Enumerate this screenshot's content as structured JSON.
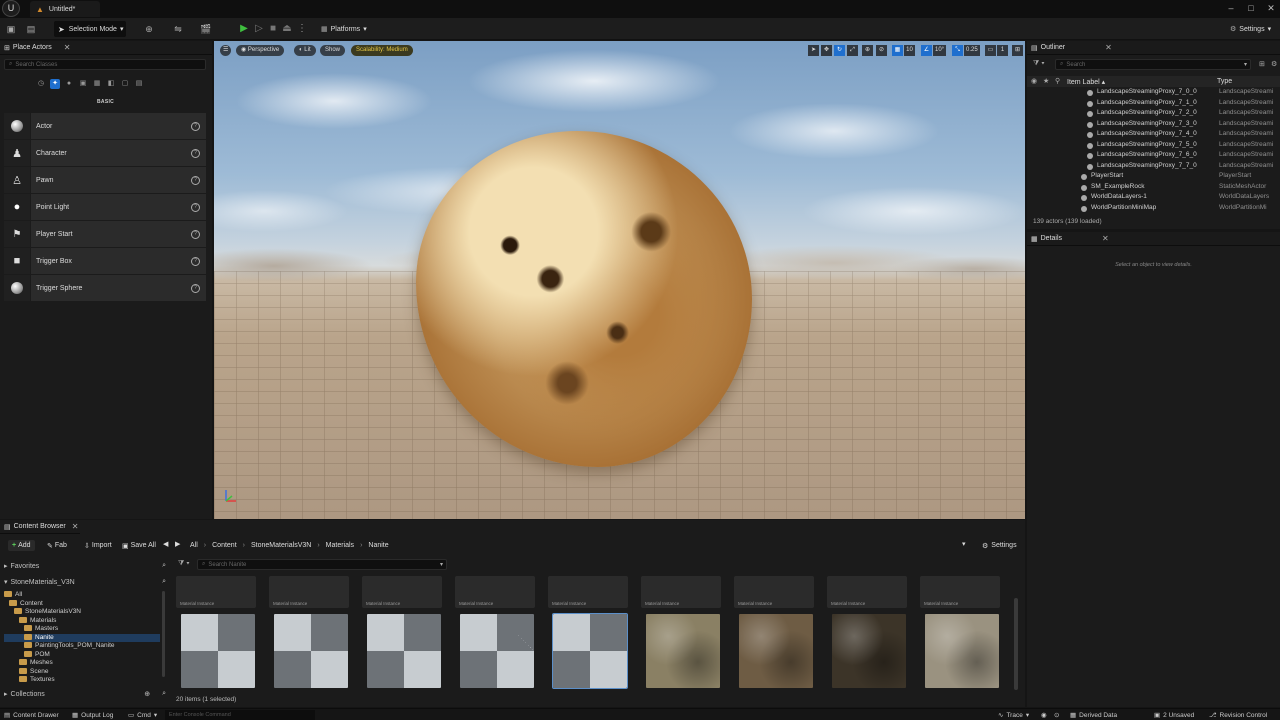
{
  "window": {
    "doc_tab": "Untitled*",
    "controls": [
      "–",
      "□",
      "✕"
    ]
  },
  "toolbar": {
    "selection_mode": "Selection Mode",
    "platforms": "Platforms",
    "settings": "Settings"
  },
  "place_actors": {
    "title": "Place Actors",
    "search_placeholder": "Search Classes",
    "category": "BASIC",
    "items": [
      {
        "label": "Actor"
      },
      {
        "label": "Character"
      },
      {
        "label": "Pawn"
      },
      {
        "label": "Point Light"
      },
      {
        "label": "Player Start"
      },
      {
        "label": "Trigger Box"
      },
      {
        "label": "Trigger Sphere"
      }
    ]
  },
  "viewport": {
    "perspective": "Perspective",
    "lit": "Lit",
    "show": "Show",
    "scalability": "Scalability: Medium",
    "grid_value": "10",
    "angle_value": "10°",
    "scale_value": "0.25",
    "camera_value": "1"
  },
  "outliner": {
    "title": "Outliner",
    "search_placeholder": "Search",
    "col_label": "Item Label ▴",
    "col_type": "Type",
    "rows": [
      {
        "label": "LandscapeStreamingProxy_7_0_0",
        "type": "LandscapeStreami"
      },
      {
        "label": "LandscapeStreamingProxy_7_1_0",
        "type": "LandscapeStreami"
      },
      {
        "label": "LandscapeStreamingProxy_7_2_0",
        "type": "LandscapeStreami"
      },
      {
        "label": "LandscapeStreamingProxy_7_3_0",
        "type": "LandscapeStreami"
      },
      {
        "label": "LandscapeStreamingProxy_7_4_0",
        "type": "LandscapeStreami"
      },
      {
        "label": "LandscapeStreamingProxy_7_5_0",
        "type": "LandscapeStreami"
      },
      {
        "label": "LandscapeStreamingProxy_7_6_0",
        "type": "LandscapeStreami"
      },
      {
        "label": "LandscapeStreamingProxy_7_7_0",
        "type": "LandscapeStreami"
      },
      {
        "label": "PlayerStart",
        "type": "PlayerStart"
      },
      {
        "label": "SM_ExampleRock",
        "type": "StaticMeshActor"
      },
      {
        "label": "WorldDataLayers-1",
        "type": "WorldDataLayers"
      },
      {
        "label": "WorldPartitionMiniMap",
        "type": "WorldPartitionMi"
      }
    ],
    "count": "139 actors (139 loaded)"
  },
  "details": {
    "title": "Details",
    "empty": "Select an object to view details."
  },
  "content_browser": {
    "title": "Content Browser",
    "add": "Add",
    "fab": "Fab",
    "import": "Import",
    "save_all": "Save All",
    "breadcrumb": [
      "All",
      "Content",
      "StoneMaterialsV3N",
      "Materials",
      "Nanite"
    ],
    "settings": "Settings",
    "favorites": "Favorites",
    "project": "StoneMaterials_V3N",
    "search_placeholder": "Search Nanite",
    "tree": [
      {
        "label": "All",
        "indent": 0
      },
      {
        "label": "Content",
        "indent": 1
      },
      {
        "label": "StoneMaterialsV3N",
        "indent": 2
      },
      {
        "label": "Materials",
        "indent": 3
      },
      {
        "label": "Masters",
        "indent": 4
      },
      {
        "label": "Nanite",
        "indent": 4,
        "selected": true
      },
      {
        "label": "PaintingTools_POM_Nanite",
        "indent": 4
      },
      {
        "label": "POM",
        "indent": 4
      },
      {
        "label": "Meshes",
        "indent": 3
      },
      {
        "label": "Scene",
        "indent": 3
      },
      {
        "label": "Textures",
        "indent": 3
      }
    ],
    "collections": "Collections",
    "asset_caption": "Material Instance",
    "tiles": [
      {
        "kind": "checker"
      },
      {
        "kind": "checker"
      },
      {
        "kind": "checker"
      },
      {
        "kind": "checker"
      },
      {
        "kind": "checker",
        "selected": true
      },
      {
        "kind": "stone",
        "color": "#8a8064"
      },
      {
        "kind": "stone",
        "color": "#6e5c44"
      },
      {
        "kind": "stone",
        "color": "#3c3428"
      },
      {
        "kind": "stone",
        "color": "#9a9280"
      }
    ],
    "status": "20 items (1 selected)"
  },
  "bottombar": {
    "content_drawer": "Content Drawer",
    "output_log": "Output Log",
    "cmd": "Cmd",
    "console_placeholder": "Enter Console Command",
    "trace": "Trace",
    "derived_data": "Derived Data",
    "unsaved": "2 Unsaved",
    "revision": "Revision Control"
  }
}
